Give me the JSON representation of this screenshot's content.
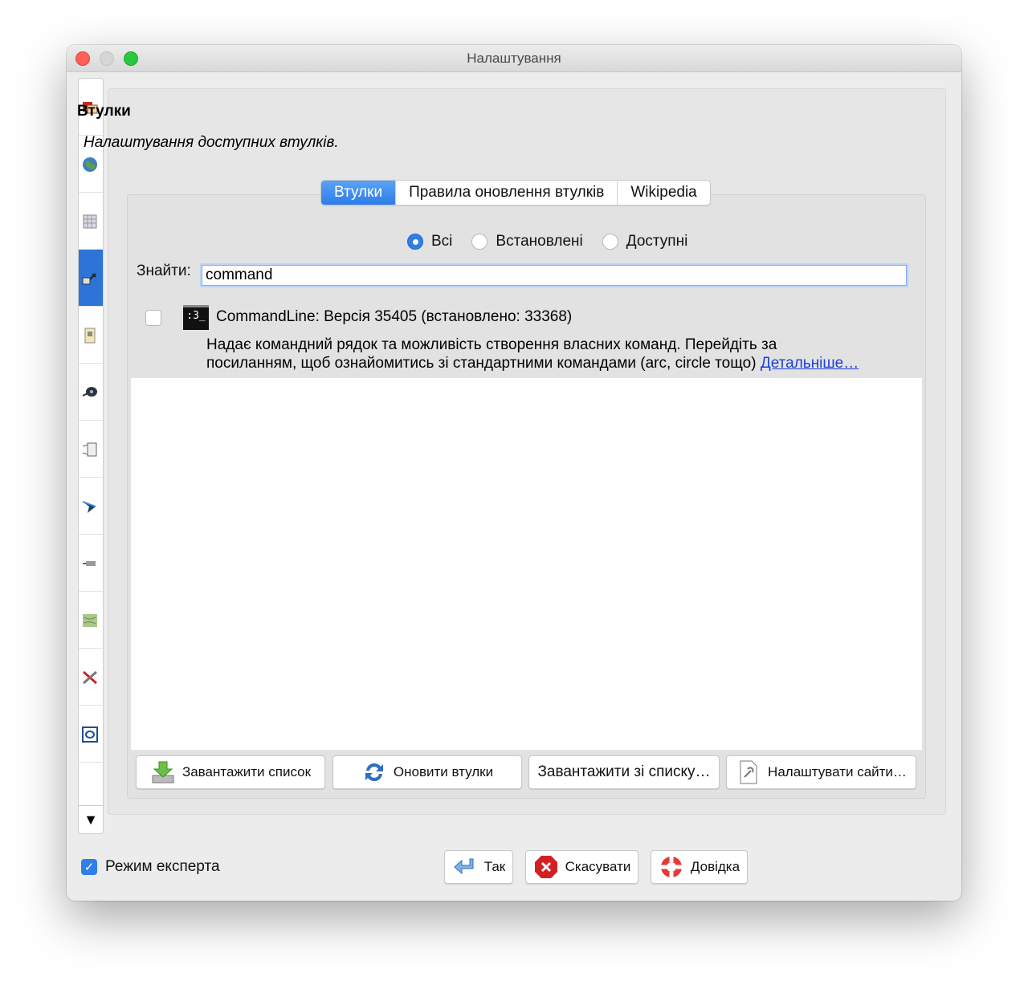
{
  "window": {
    "title": "Налаштування"
  },
  "sidebar": {
    "items": [
      {
        "icon": "preferences-display-icon"
      },
      {
        "icon": "globe-icon"
      },
      {
        "icon": "map-grid-icon"
      },
      {
        "icon": "plugin-plug-icon",
        "active": true
      },
      {
        "icon": "document-edit-icon"
      },
      {
        "icon": "remote-control-icon"
      },
      {
        "icon": "projection-icon"
      },
      {
        "icon": "arrow-icon"
      },
      {
        "icon": "imagery-offset-icon"
      },
      {
        "icon": "map-paint-icon"
      },
      {
        "icon": "shortcuts-tools-icon"
      },
      {
        "icon": "validator-icon"
      }
    ],
    "scroll_down": "▼"
  },
  "panel": {
    "heading": "Втулки",
    "subtitle": "Налаштування доступних втулків."
  },
  "tabs": [
    {
      "label": "Втулки",
      "selected": true
    },
    {
      "label": "Правила оновлення втулків"
    },
    {
      "label": "Wikipedia"
    }
  ],
  "filter": {
    "options": [
      "Всі",
      "Встановлені",
      "Доступні"
    ],
    "selected": "Всі"
  },
  "search": {
    "label": "Знайти:",
    "value": "command"
  },
  "plugin": {
    "icon_text": ":3_",
    "title": "CommandLine: Версія 35405 (встановлено: 33368)",
    "desc_line1": "Надає командний рядок та можливість створення власних команд. Перейдіть за",
    "desc_line2": "посиланням, щоб ознайомитись зі стандартними командами (arc, circle тощо)",
    "more_link": "Детальніше…",
    "checked": false
  },
  "buttons": {
    "download_list": "Завантажити список",
    "update_plugins": "Оновити втулки",
    "load_from_list": "Завантажити зі списку…",
    "configure_sites": "Налаштувати сайти…"
  },
  "footer": {
    "expert_mode": "Режим експерта",
    "expert_checked": true,
    "ok": "Так",
    "cancel": "Скасувати",
    "help": "Довідка"
  },
  "colors": {
    "accent": "#2f7fe8",
    "link": "#1c3fd6",
    "window_bg": "#ececec"
  }
}
